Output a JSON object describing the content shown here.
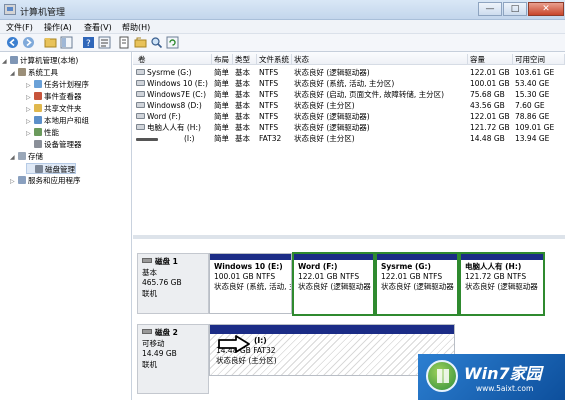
{
  "window": {
    "title": "计算机管理",
    "min": "—",
    "max": "□",
    "close": "✕"
  },
  "menu": [
    "文件(F)",
    "操作(A)",
    "查看(V)",
    "帮助(H)"
  ],
  "toolbar": [
    "back-icon",
    "forward-icon",
    "up-folder-icon",
    "show-tree-icon",
    "help-icon",
    "properties-icon",
    "open-folder-icon",
    "explore-icon",
    "search-icon",
    "refresh-icon"
  ],
  "tree": [
    {
      "label": "计算机管理(本地)",
      "icon": "computer-icon",
      "level": 0,
      "arrow": "◢"
    },
    {
      "label": "系统工具",
      "icon": "tools-icon",
      "level": 1,
      "arrow": "◢"
    },
    {
      "label": "任务计划程序",
      "icon": "clock-icon",
      "level": 2,
      "arrow": "▷"
    },
    {
      "label": "事件查看器",
      "icon": "event-icon",
      "level": 2,
      "arrow": "▷"
    },
    {
      "label": "共享文件夹",
      "icon": "shared-folder-icon",
      "level": 2,
      "arrow": "▷"
    },
    {
      "label": "本地用户和组",
      "icon": "users-icon",
      "level": 2,
      "arrow": "▷"
    },
    {
      "label": "性能",
      "icon": "performance-icon",
      "level": 2,
      "arrow": "▷"
    },
    {
      "label": "设备管理器",
      "icon": "device-icon",
      "level": 2,
      "arrow": ""
    },
    {
      "label": "存储",
      "icon": "storage-icon",
      "level": 1,
      "arrow": "◢"
    },
    {
      "label": "磁盘管理",
      "icon": "disk-icon",
      "level": 2,
      "arrow": ""
    },
    {
      "label": "服务和应用程序",
      "icon": "services-icon",
      "level": 1,
      "arrow": "▷"
    }
  ],
  "volumes": {
    "columns": [
      "卷",
      "布局",
      "类型",
      "文件系统",
      "状态",
      "容量",
      "可用空间"
    ],
    "rows": [
      [
        "Sysrme (G:)",
        "简单",
        "基本",
        "NTFS",
        "状态良好 (逻辑驱动器)",
        "122.01 GB",
        "103.61 GE"
      ],
      [
        "Windows 10 (E:)",
        "简单",
        "基本",
        "NTFS",
        "状态良好 (系统, 活动, 主分区)",
        "100.01 GB",
        "53.40 GE"
      ],
      [
        "Windows7E (C:)",
        "简单",
        "基本",
        "NTFS",
        "状态良好 (启动, 页面文件, 故障转储, 主分区)",
        "75.68 GB",
        "15.30 GE"
      ],
      [
        "Windows8 (D:)",
        "简单",
        "基本",
        "NTFS",
        "状态良好 (主分区)",
        "43.56 GB",
        "7.60 GE"
      ],
      [
        "Word (F:)",
        "简单",
        "基本",
        "NTFS",
        "状态良好 (逻辑驱动器)",
        "122.01 GB",
        "78.86 GE"
      ],
      [
        "电脑人人有 (H:)",
        "简单",
        "基本",
        "NTFS",
        "状态良好 (逻辑驱动器)",
        "121.72 GB",
        "109.01 GE"
      ],
      [
        "(I:)",
        "简单",
        "基本",
        "FAT32",
        "状态良好 (主分区)",
        "14.48 GB",
        "13.94 GE"
      ]
    ]
  },
  "disks": [
    {
      "name": "磁盘 1",
      "type": "基本",
      "size": "465.76 GB",
      "state": "联机",
      "partitions": [
        {
          "name": "Windows 10 (E:)",
          "size": "100.01 GB NTFS",
          "status": "状态良好 (系统, 活动, 主",
          "selected": false
        },
        {
          "name": "Word (F:)",
          "size": "122.01 GB NTFS",
          "status": "状态良好 (逻辑驱动器",
          "selected": true
        },
        {
          "name": "Sysrme (G:)",
          "size": "122.01 GB NTFS",
          "status": "状态良好 (逻辑驱动器",
          "selected": true
        },
        {
          "name": "电脑人人有 (H:)",
          "size": "121.72 GB NTFS",
          "status": "状态良好 (逻辑驱动器",
          "selected": true
        }
      ]
    },
    {
      "name": "磁盘 2",
      "type": "可移动",
      "size": "14.49 GB",
      "state": "联机",
      "partitions": [
        {
          "name": "(I:)",
          "size": "14.48 GB FAT32",
          "status": "状态良好 (主分区)",
          "selected": false
        }
      ]
    }
  ],
  "watermark": {
    "brand": "Win7家园",
    "url": "www.5aixt.com"
  }
}
